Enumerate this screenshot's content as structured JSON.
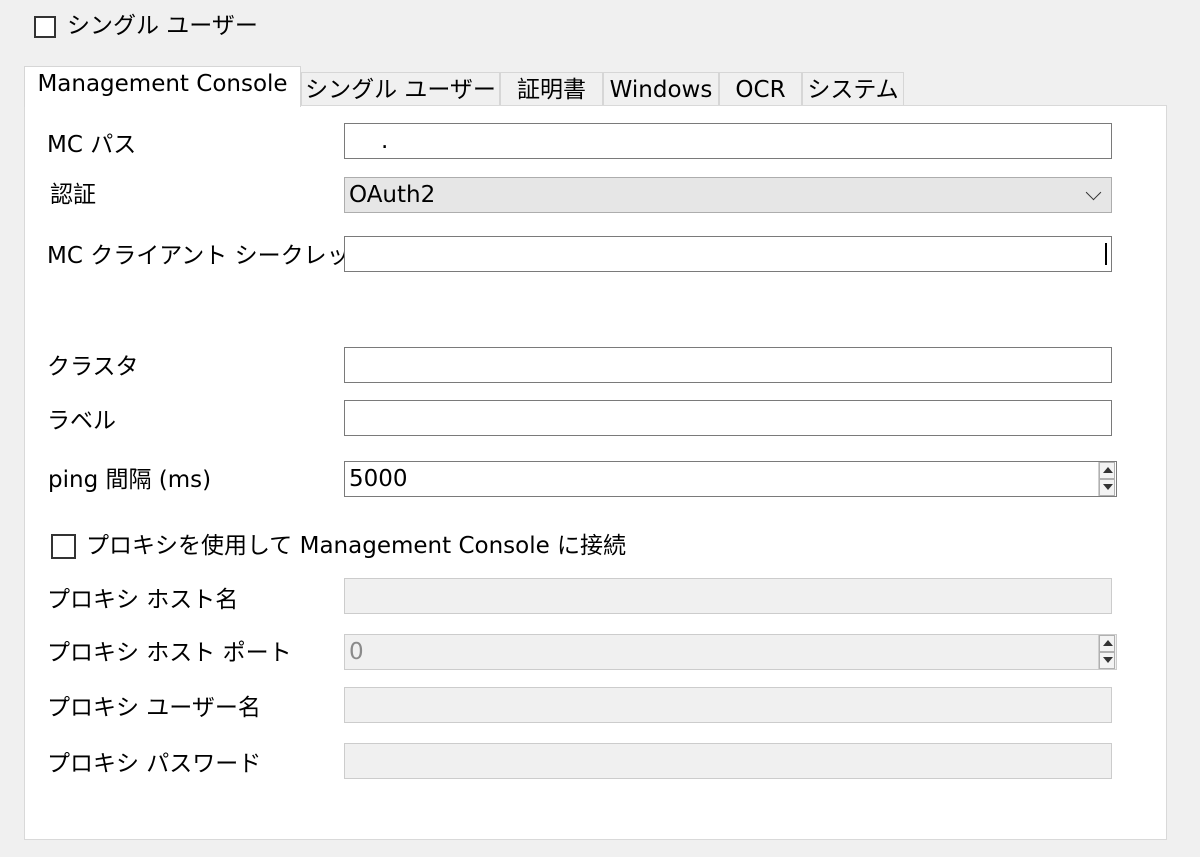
{
  "top_checkbox": {
    "label": "シングル ユーザー",
    "checked": false
  },
  "tabs": [
    {
      "label": "Management Console",
      "active": true
    },
    {
      "label": "シングル ユーザー",
      "active": false
    },
    {
      "label": "証明書",
      "active": false
    },
    {
      "label": "Windows",
      "active": false
    },
    {
      "label": "OCR",
      "active": false
    },
    {
      "label": "システム",
      "active": false
    }
  ],
  "form": {
    "mc_path": {
      "label": "MC パス",
      "value": "."
    },
    "auth": {
      "label": "認証",
      "value": "OAuth2"
    },
    "client_secret": {
      "label": "MC クライアント シークレット",
      "value": ""
    },
    "cluster": {
      "label": "クラスタ",
      "value": ""
    },
    "label_field": {
      "label": "ラベル",
      "value": ""
    },
    "ping_interval": {
      "label": "ping 間隔 (ms)",
      "value": "5000"
    },
    "use_proxy": {
      "label": "プロキシを使用して Management Console に接続",
      "checked": false
    },
    "proxy_host": {
      "label": "プロキシ ホスト名",
      "value": ""
    },
    "proxy_port": {
      "label": "プロキシ ホスト ポート",
      "value": "0"
    },
    "proxy_user": {
      "label": "プロキシ ユーザー名",
      "value": ""
    },
    "proxy_password": {
      "label": "プロキシ パスワード",
      "value": ""
    }
  }
}
